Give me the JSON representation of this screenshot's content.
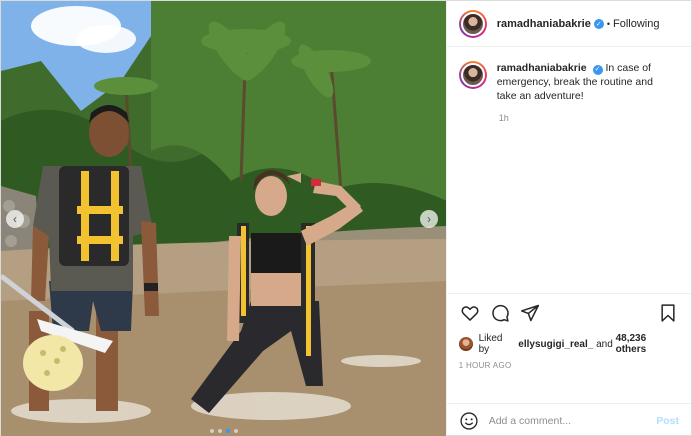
{
  "header": {
    "username": "ramadhaniabakrie",
    "separator": "•",
    "follow_status": "Following"
  },
  "caption": {
    "username": "ramadhaniabakrie",
    "text": "In case of emergency, break the routine and take an adventure!",
    "time": "1h"
  },
  "likes": {
    "prefix": "Liked by ",
    "user": "ellysugigi_real_",
    "middle": " and ",
    "count": "48,236 others"
  },
  "posted_ago": "1 HOUR AGO",
  "comment_input": {
    "placeholder": "Add a comment...",
    "post_label": "Post"
  },
  "carousel": {
    "prev_glyph": "‹",
    "next_glyph": "›",
    "total_slides": 4,
    "active_slide": 3
  },
  "icons": {
    "like": "heart-icon",
    "comment": "comment-icon",
    "share": "share-icon",
    "save": "bookmark-icon",
    "emoji": "smile-icon",
    "verified": "verified-badge-icon"
  },
  "colors": {
    "accent": "#3897f0",
    "post_button_disabled": "#b2dffc",
    "muted": "#8e8e8e"
  }
}
